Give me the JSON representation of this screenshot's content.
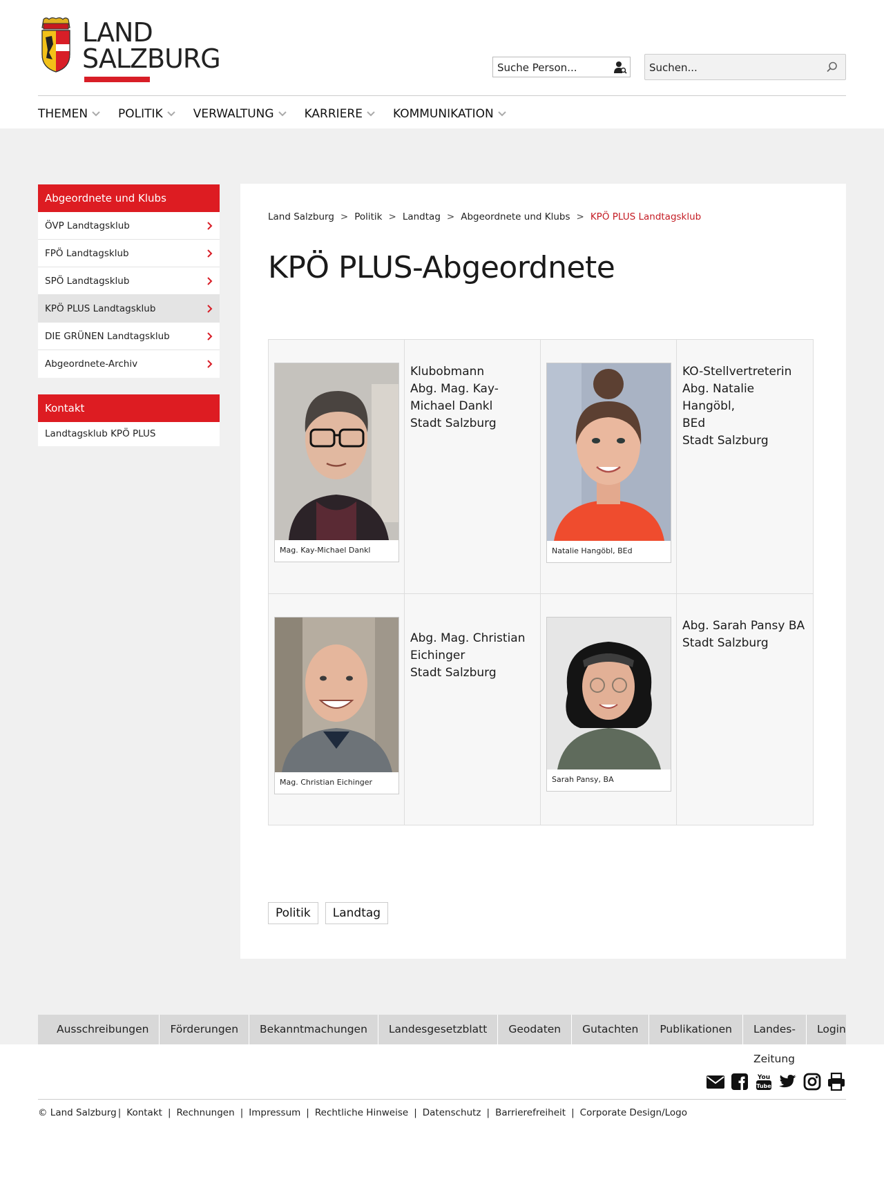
{
  "header": {
    "logo_line1": "LAND",
    "logo_line2": "SALZBURG",
    "person_search_placeholder": "Suche Person...",
    "site_search_placeholder": "Suchen..."
  },
  "mainnav": [
    "THEMEN",
    "POLITIK",
    "VERWALTUNG",
    "KARRIERE",
    "KOMMUNIKATION"
  ],
  "sidebar": {
    "heading": "Abgeordnete und Klubs",
    "items": [
      {
        "label": "ÖVP Landtagsklub"
      },
      {
        "label": "FPÖ Landtagsklub"
      },
      {
        "label": "SPÖ Landtagsklub"
      },
      {
        "label": "KPÖ PLUS Landtagsklub",
        "active": true
      },
      {
        "label": "DIE GRÜNEN Landtagsklub"
      },
      {
        "label": "Abgeordnete-Archiv"
      }
    ],
    "contact_heading": "Kontakt",
    "contact_item": "Landtagsklub KPÖ PLUS"
  },
  "breadcrumb": [
    "Land Salzburg",
    "Politik",
    "Landtag",
    "Abgeordnete und Klubs"
  ],
  "breadcrumb_current": "KPÖ PLUS Landtagsklub",
  "page_title": "KPÖ PLUS-Abgeordnete",
  "members": [
    {
      "caption": "Mag. Kay-Michael Dankl",
      "lines": [
        "Klubobmann",
        "Abg. Mag. Kay-",
        "Michael Dankl",
        "Stadt Salzburg"
      ]
    },
    {
      "caption": "Natalie Hangöbl, BEd",
      "lines": [
        "KO-Stellvertreterin",
        "Abg. Natalie Hangöbl,",
        "BEd",
        "Stadt Salzburg"
      ]
    },
    {
      "caption": "Mag. Christian Eichinger",
      "lines": [
        "Abg. Mag. Christian",
        "Eichinger",
        "Stadt Salzburg"
      ]
    },
    {
      "caption": "Sarah Pansy, BA",
      "lines": [
        "Abg. Sarah Pansy BA",
        "Stadt Salzburg"
      ]
    }
  ],
  "tags": [
    "Politik",
    "Landtag"
  ],
  "footer_nav": [
    "Ausschreibungen",
    "Förderungen",
    "Bekanntmachungen",
    "Landesgesetzblatt",
    "Geodaten",
    "Gutachten",
    "Publikationen",
    "Landes-Zeitung",
    "Login"
  ],
  "social_icons": [
    "mail-icon",
    "facebook-icon",
    "youtube-icon",
    "twitter-icon",
    "instagram-icon",
    "print-icon"
  ],
  "footer_links": [
    "© Land Salzburg",
    "Kontakt",
    "Rechnungen",
    "Impressum",
    "Rechtliche Hinweise",
    "Datenschutz",
    "Barrierefreiheit",
    "Corporate Design/Logo"
  ],
  "colors": {
    "brand_red": "#dd1c22",
    "breadcrumb_current": "#c41c24",
    "page_background": "#f0f0f0"
  }
}
